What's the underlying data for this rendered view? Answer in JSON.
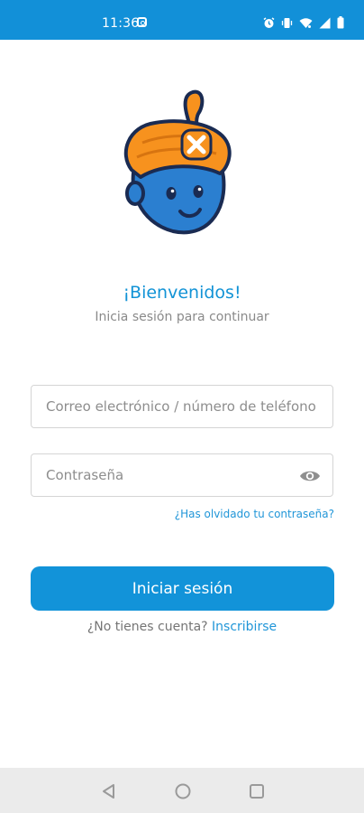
{
  "status_bar": {
    "time": "11:36",
    "icons": [
      "instagram-icon",
      "alarm-icon",
      "vibrate-icon",
      "wifi-icon",
      "signal-icon",
      "battery-icon"
    ],
    "background": "#1290d8"
  },
  "brand": {
    "mascot": "genie-mascot-logo"
  },
  "login": {
    "welcome_title": "¡Bienvenidos!",
    "subtitle": "Inicia sesión para continuar",
    "email_placeholder": "Correo electrónico / número de teléfono",
    "email_value": "",
    "password_placeholder": "Contraseña",
    "password_value": "",
    "forgot_password": "¿Has olvidado tu contraseña?",
    "submit_label": "Iniciar sesión",
    "no_account_prompt": "¿No tienes cuenta?",
    "signup_link": "Inscribirse"
  },
  "colors": {
    "accent": "#1293d9",
    "turban": "#f7921e",
    "face": "#2b7fd0"
  },
  "nav_bar": {
    "buttons": [
      "back-icon",
      "home-icon",
      "recents-icon"
    ]
  }
}
